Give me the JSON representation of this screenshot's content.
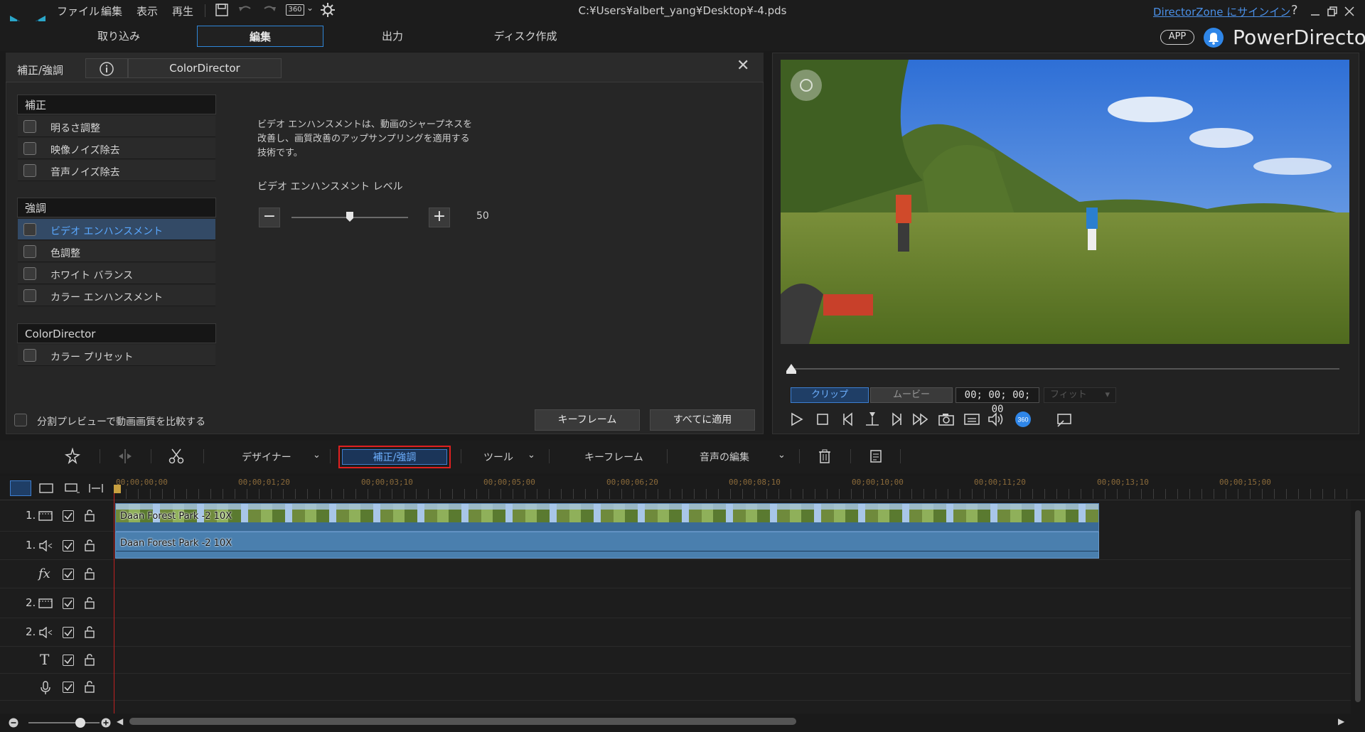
{
  "menu": {
    "file": "ファイル",
    "edit": "編集",
    "view": "表示",
    "play": "再生",
    "view360": "360"
  },
  "window": {
    "title": "C:¥Users¥albert_yang¥Desktop¥-4.pds",
    "signin": "DirectorZone にサインイン",
    "help": "?",
    "app_badge": "APP",
    "brand": "PowerDirector"
  },
  "mode_tabs": [
    "取り込み",
    "編集",
    "出力",
    "ディスク作成"
  ],
  "panel": {
    "title": "補正/強調",
    "colordirector_tab": "ColorDirector",
    "groups": [
      {
        "header": "補正",
        "items": [
          "明るさ調整",
          "映像ノイズ除去",
          "音声ノイズ除去"
        ]
      },
      {
        "header": "強調",
        "items": [
          "ビデオ エンハンスメント",
          "色調整",
          "ホワイト バランス",
          "カラー エンハンスメント"
        ]
      },
      {
        "header": "ColorDirector",
        "items": [
          "カラー プリセット"
        ]
      }
    ],
    "selected_item": "ビデオ エンハンスメント",
    "description": "ビデオ エンハンスメントは、動画のシャープネスを改善し、画質改善のアップサンプリングを適用する技術です。",
    "level_label": "ビデオ エンハンスメント レベル",
    "level_value": "50",
    "level_fraction": 0.5,
    "split_preview_label": "分割プレビューで動画画質を比較する",
    "keyframe_btn": "キーフレーム",
    "apply_all_btn": "すべてに適用"
  },
  "preview": {
    "tab_clip": "クリップ",
    "tab_movie": "ムービー",
    "timecode": "00; 00; 00; 00",
    "fit": "フィット"
  },
  "toolbar": {
    "designer": "デザイナー",
    "fix_enhance": "補正/強調",
    "tools": "ツール",
    "keyframe": "キーフレーム",
    "audio_edit": "音声の編集"
  },
  "timeline": {
    "ticks": [
      "00;00;00;00",
      "00;00;01;20",
      "00;00;03;10",
      "00;00;05;00",
      "00;00;06;20",
      "00;00;08;10",
      "00;00;10;00",
      "00;00;11;20",
      "00;00;13;10",
      "00;00;15;00"
    ],
    "tracks": [
      {
        "num": "1.",
        "type": "video"
      },
      {
        "num": "1.",
        "type": "audio"
      },
      {
        "num": "",
        "type": "fx"
      },
      {
        "num": "2.",
        "type": "video"
      },
      {
        "num": "2.",
        "type": "audio"
      },
      {
        "num": "",
        "type": "title"
      },
      {
        "num": "",
        "type": "voice"
      }
    ],
    "video_clip": "Daan Forest Park -2 10X",
    "audio_clip": "Daan Forest Park -2 10X"
  },
  "colors": {
    "accent_blue": "#3d7fd1",
    "highlight_red": "#e02020",
    "clip_blue": "#4a7fae"
  }
}
